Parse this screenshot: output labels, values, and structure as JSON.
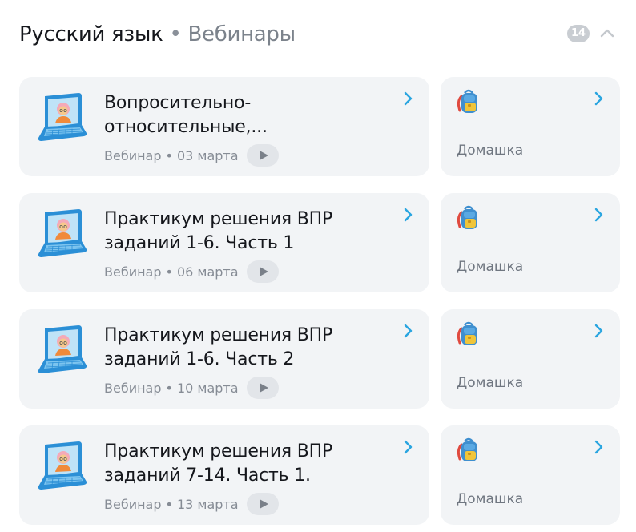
{
  "header": {
    "title": "Русский язык",
    "separator": "•",
    "subtitle": "Вебинары",
    "count": "14",
    "collapse_icon": "chevron-up-icon"
  },
  "colors": {
    "accent": "#2aa5e0",
    "card_bg": "#f2f4f6",
    "badge_bg": "#c9cdd2",
    "muted_text": "#868c95"
  },
  "lessons": [
    {
      "title_line1": "Вопросительно-",
      "title_line2": "относительные,...",
      "type": "Вебинар",
      "sep": "•",
      "date": "03 марта",
      "icon": "laptop-icon",
      "homework": {
        "label": "Домашка",
        "icon": "backpack-icon"
      }
    },
    {
      "title_line1": "Практикум решения ВПР",
      "title_line2": "заданий 1-6. Часть 1",
      "type": "Вебинар",
      "sep": "•",
      "date": "06 марта",
      "icon": "laptop-icon",
      "homework": {
        "label": "Домашка",
        "icon": "backpack-icon"
      }
    },
    {
      "title_line1": "Практикум решения ВПР",
      "title_line2": "заданий 1-6. Часть 2",
      "type": "Вебинар",
      "sep": "•",
      "date": "10 марта",
      "icon": "laptop-icon",
      "homework": {
        "label": "Домашка",
        "icon": "backpack-icon"
      }
    },
    {
      "title_line1": "Практикум решения ВПР",
      "title_line2": "заданий 7-14. Часть 1.",
      "type": "Вебинар",
      "sep": "•",
      "date": "13 марта",
      "icon": "laptop-icon",
      "homework": {
        "label": "Домашка",
        "icon": "backpack-icon"
      }
    }
  ]
}
